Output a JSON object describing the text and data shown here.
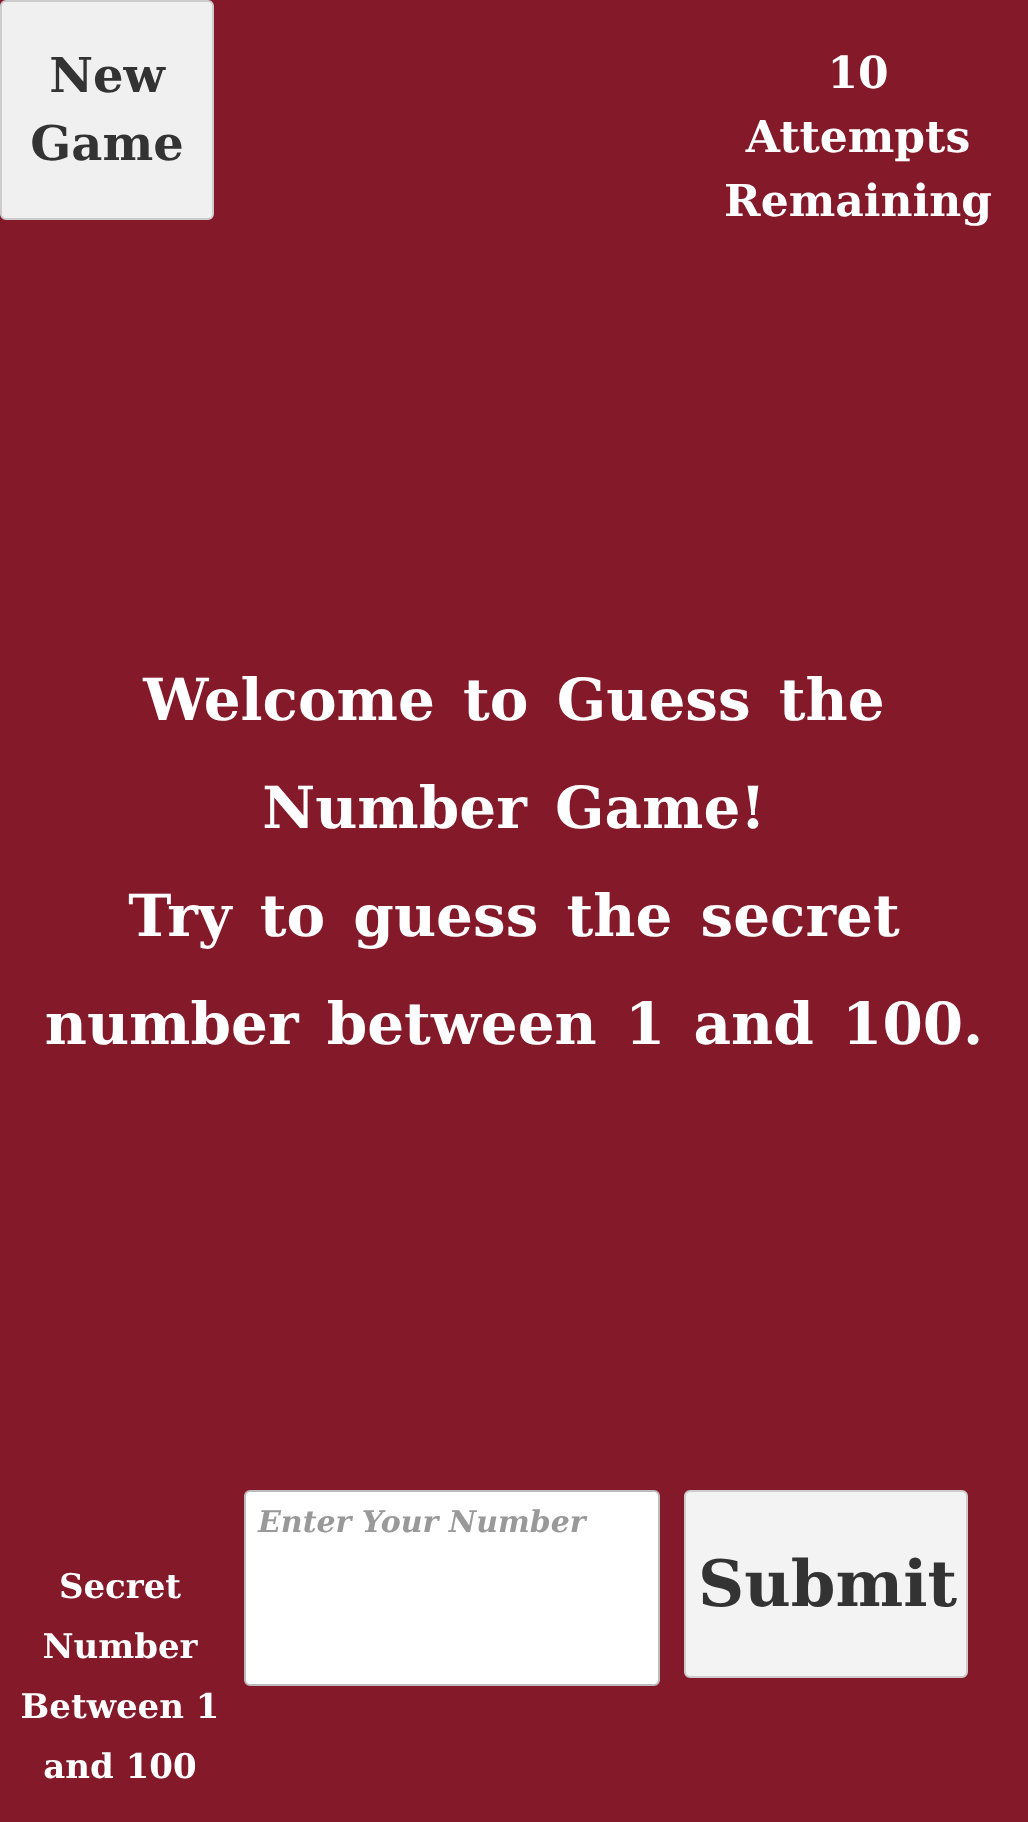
{
  "new_game_button": {
    "label": "New Game"
  },
  "attempts": {
    "count": "10",
    "label": "Attempts Remaining"
  },
  "message": {
    "lines": [
      "Welcome to Guess the Number Game!",
      "Try to guess the secret number between 1 and 100."
    ]
  },
  "guess_field": {
    "label": "Secret Number Between 1 and 100",
    "placeholder": "Enter Your Number"
  },
  "submit_button": {
    "label": "Submit"
  }
}
